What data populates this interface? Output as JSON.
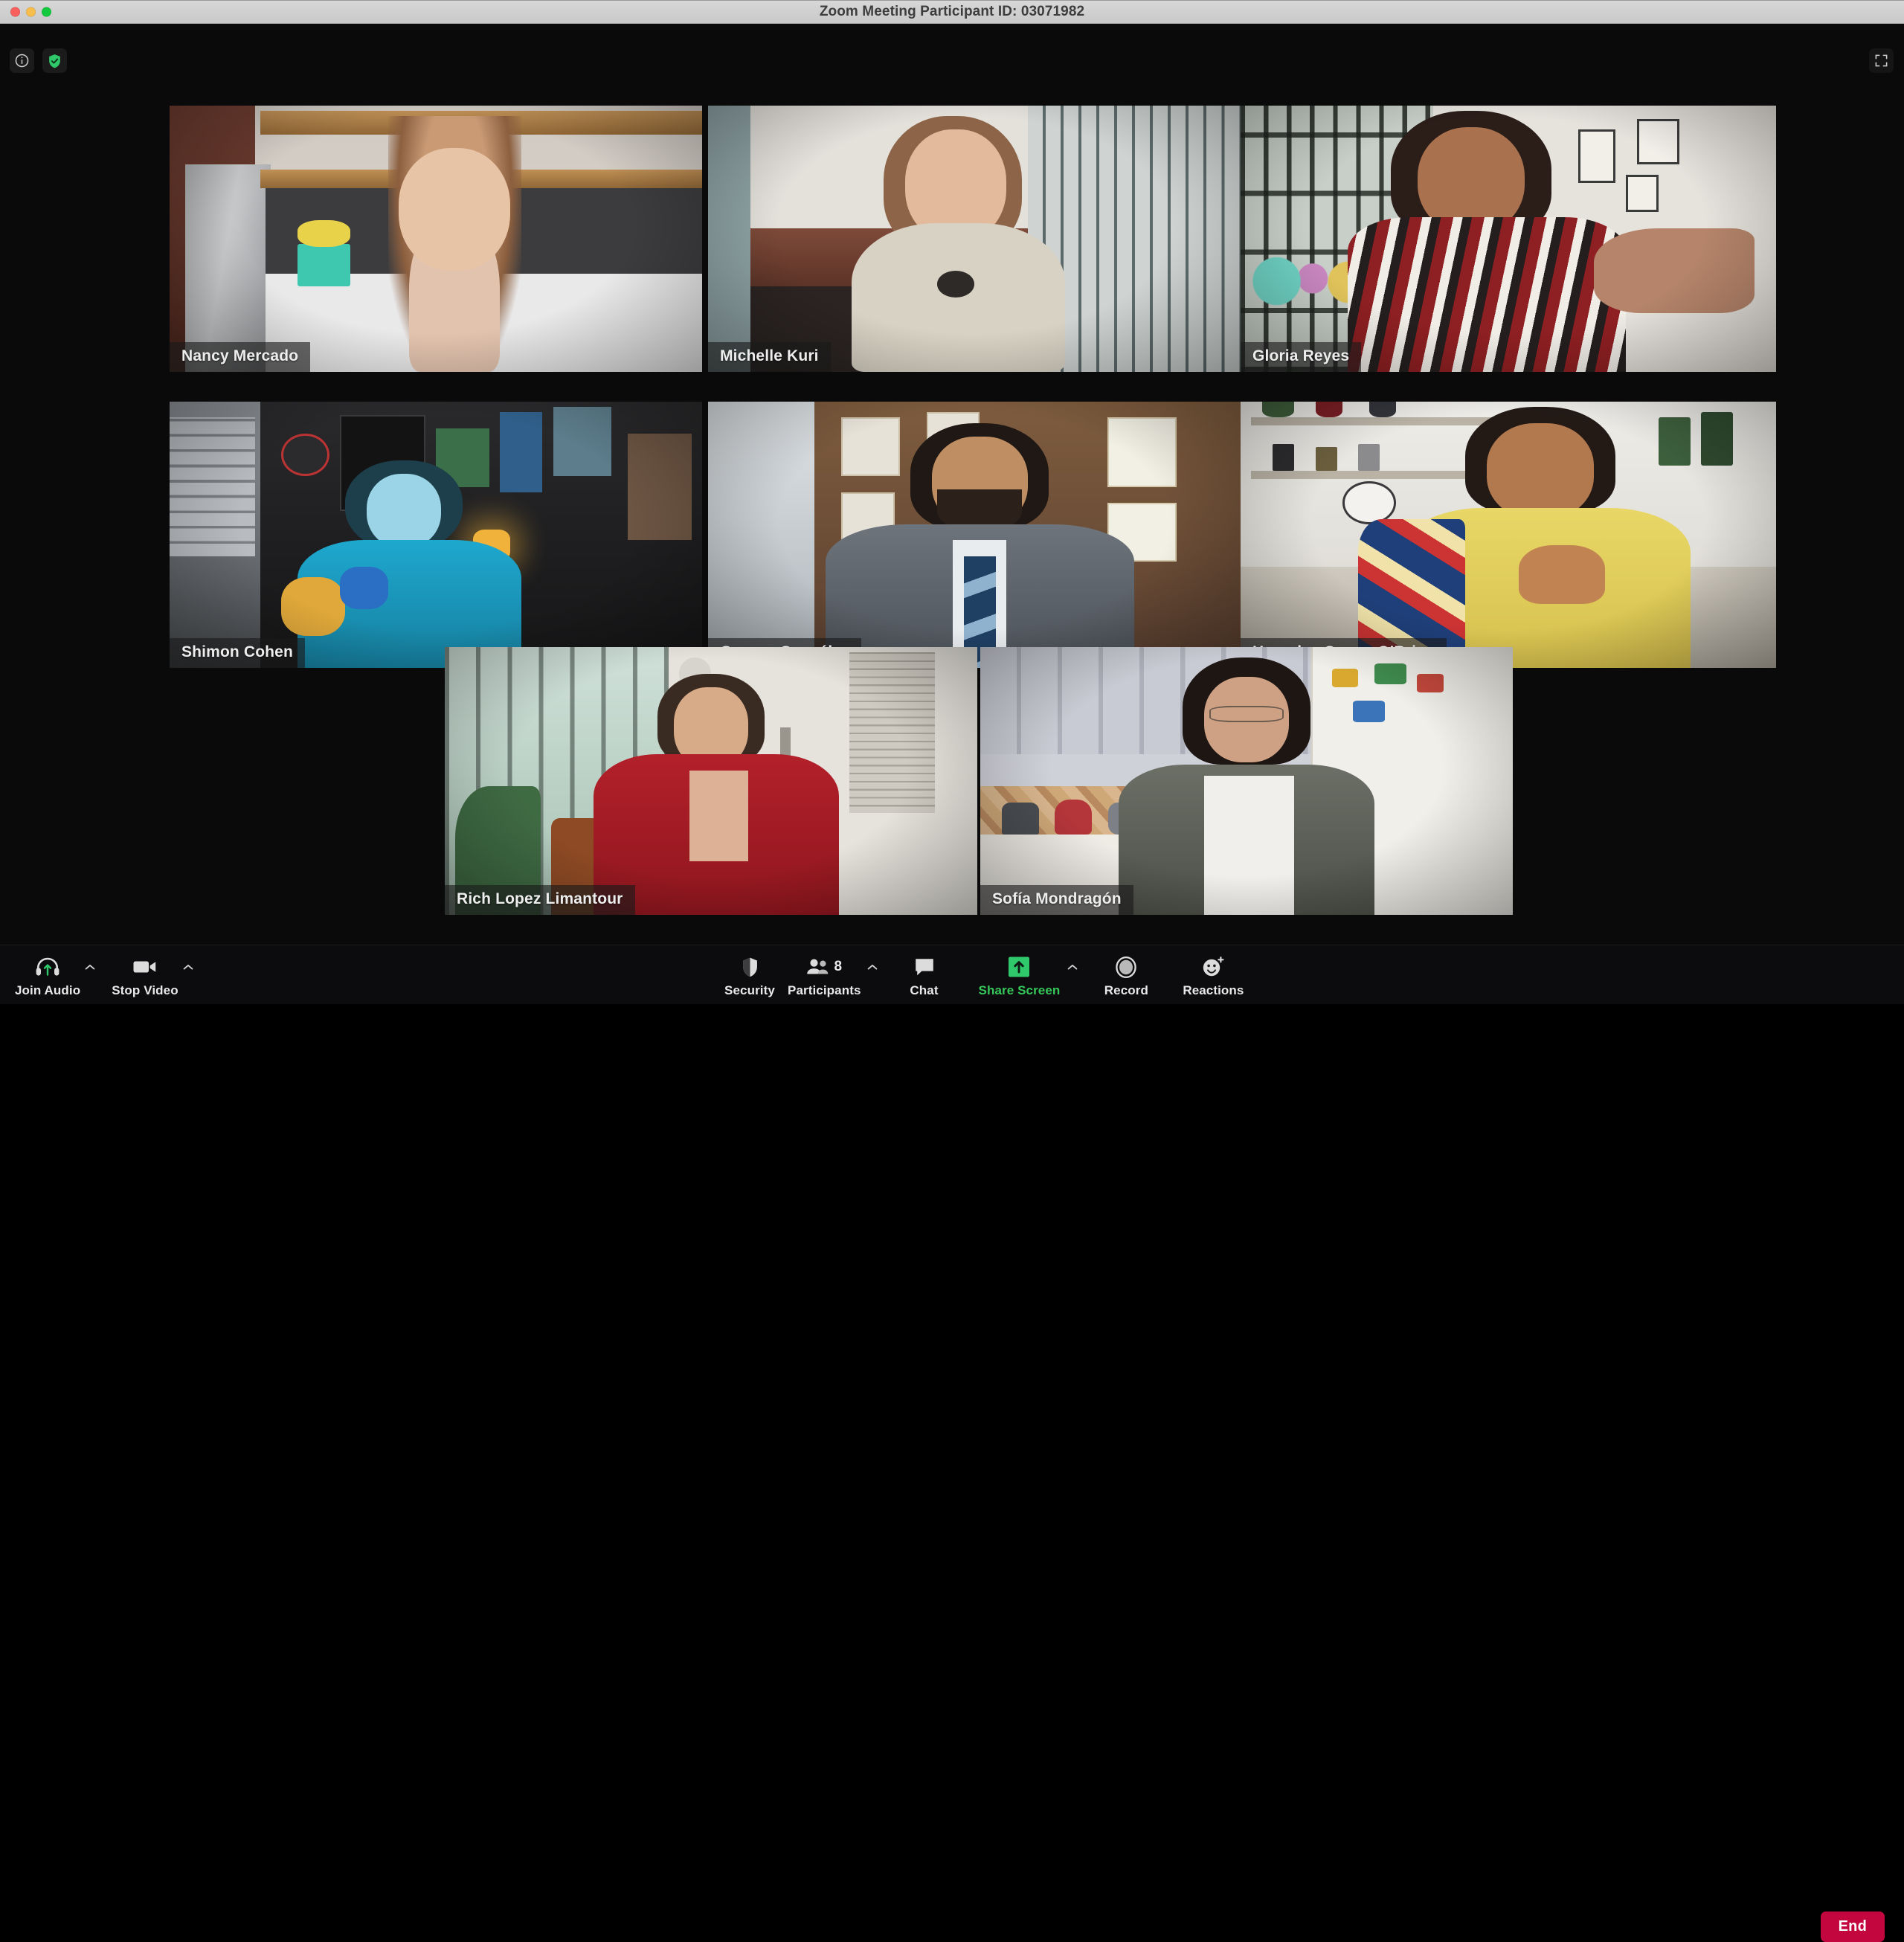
{
  "window": {
    "title": "Zoom Meeting Participant ID: 03071982",
    "traffic_lights": [
      "close",
      "minimize",
      "maximize"
    ]
  },
  "overlay_controls": {
    "info_icon": "info-icon",
    "encryption_icon": "shield-check-icon",
    "fullscreen_icon": "fullscreen-icon"
  },
  "gallery": {
    "active_speaker_color": "#35c759",
    "rows": [
      3,
      3,
      2
    ],
    "participants": [
      {
        "name": "Nancy Mercado",
        "row": 1,
        "col": 1,
        "active": false
      },
      {
        "name": "Michelle Kuri",
        "row": 1,
        "col": 2,
        "active": false
      },
      {
        "name": "Gloria Reyes",
        "row": 1,
        "col": 3,
        "active": true
      },
      {
        "name": "Shimon Cohen",
        "row": 2,
        "col": 1,
        "active": false
      },
      {
        "name": "Genaro González",
        "row": 2,
        "col": 2,
        "active": false
      },
      {
        "name": "Hercules Conan O’Brian",
        "row": 2,
        "col": 3,
        "active": false
      },
      {
        "name": "Rich Lopez Limantour",
        "row": 3,
        "col": 1,
        "active": false
      },
      {
        "name": "Sofía Mondragón",
        "row": 3,
        "col": 2,
        "active": false
      }
    ]
  },
  "toolbar": {
    "left": [
      {
        "label": "Join Audio",
        "icon": "headset-join-audio-icon",
        "caret": true
      },
      {
        "label": "Stop Video",
        "icon": "video-camera-icon",
        "caret": true
      }
    ],
    "center": [
      {
        "label": "Security",
        "icon": "shield-icon",
        "caret": false,
        "accent": false
      },
      {
        "label": "Participants",
        "icon": "participants-icon",
        "caret": true,
        "accent": false,
        "badge": "8"
      },
      {
        "label": "Chat",
        "icon": "chat-bubble-icon",
        "caret": false,
        "accent": false
      },
      {
        "label": "Share Screen",
        "icon": "share-screen-icon",
        "caret": true,
        "accent": true
      },
      {
        "label": "Record",
        "icon": "record-circle-icon",
        "caret": false,
        "accent": false
      },
      {
        "label": "Reactions",
        "icon": "reactions-icon",
        "caret": false,
        "accent": false
      }
    ],
    "end_button": {
      "label": "End",
      "color": "#c3063d"
    }
  }
}
